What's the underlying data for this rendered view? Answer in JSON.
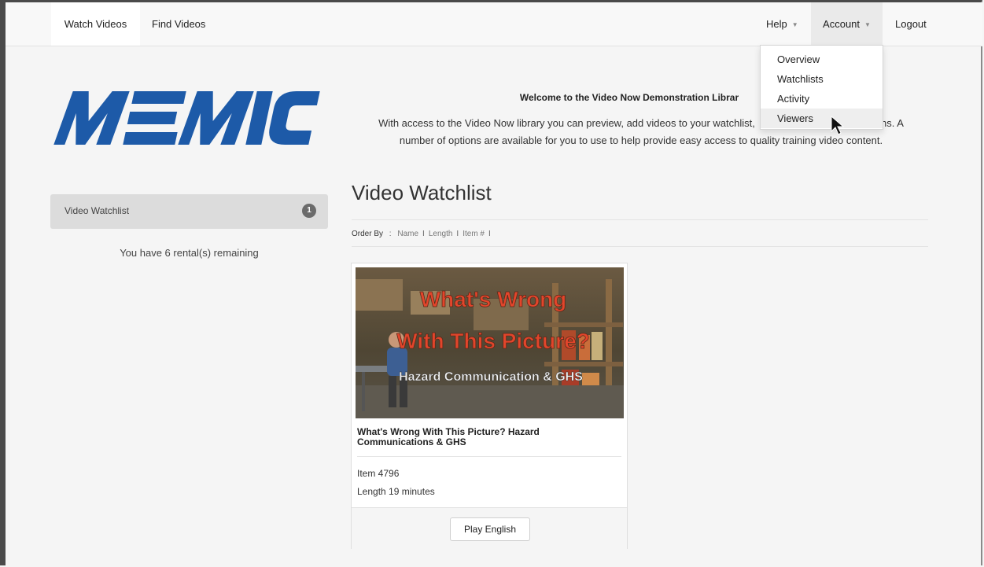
{
  "navbar": {
    "watch_videos": "Watch Videos",
    "find_videos": "Find Videos",
    "help": "Help",
    "account": "Account",
    "logout": "Logout"
  },
  "account_menu": {
    "items": [
      "Overview",
      "Watchlists",
      "Activity",
      "Viewers"
    ],
    "hovered": "Viewers"
  },
  "logo": {
    "text": "MEMIC",
    "color": "#1d5aa8"
  },
  "welcome": {
    "title": "Welcome to the Video Now Demonstration Librar",
    "text_line1": "With access to the Video Now library you can preview, add videos to your watchlist,",
    "text_line1_tail": "ions. A",
    "text_line2": "number of options are available for you to use to help provide easy access to quality training video content."
  },
  "sidebar": {
    "watchlist_label": "Video Watchlist",
    "watchlist_count": "1",
    "rentals_text": "You have 6 rental(s) remaining"
  },
  "main": {
    "title": "Video Watchlist",
    "order_by_label": "Order By",
    "order_options": [
      "Name",
      "Length",
      "Item #"
    ]
  },
  "video_card": {
    "thumb_line1": "What's Wrong",
    "thumb_line2": "With This Picture?",
    "thumb_line3": "Hazard Communication & GHS",
    "title": "What's Wrong With This Picture? Hazard Communications & GHS",
    "item": "Item 4796",
    "length": "Length 19 minutes",
    "play_button": "Play English"
  }
}
